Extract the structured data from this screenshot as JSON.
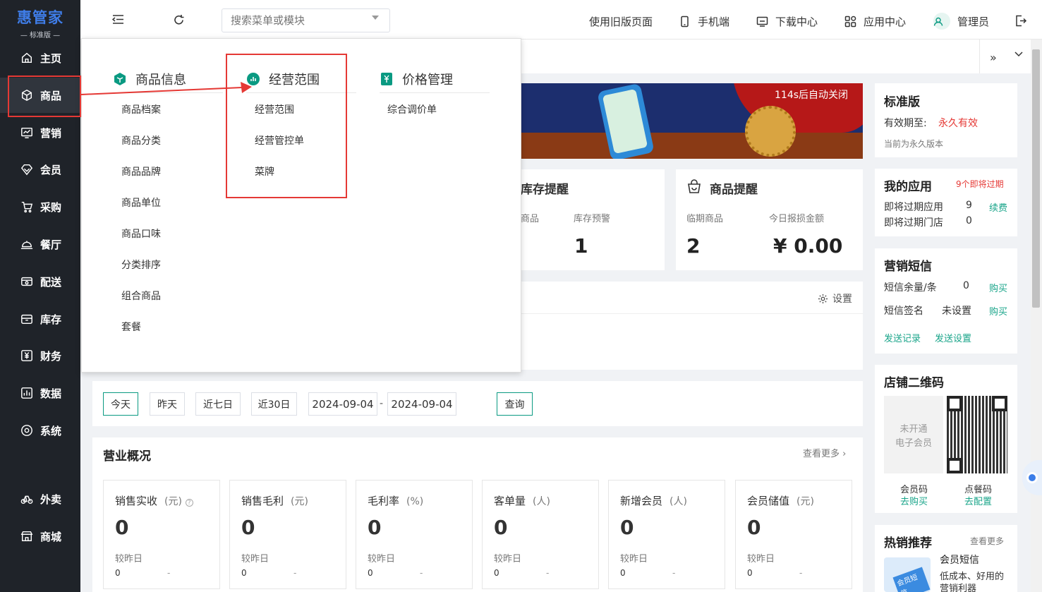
{
  "app": {
    "logo": "惠管家",
    "edition": "— 标准版 —"
  },
  "sidebar": {
    "items": [
      {
        "label": "主页",
        "icon": "home-icon"
      },
      {
        "label": "商品",
        "icon": "box-icon"
      },
      {
        "label": "营销",
        "icon": "chart-icon"
      },
      {
        "label": "会员",
        "icon": "diamond-icon"
      },
      {
        "label": "采购",
        "icon": "cart-icon"
      },
      {
        "label": "餐厅",
        "icon": "cloche-icon"
      },
      {
        "label": "配送",
        "icon": "truck-icon"
      },
      {
        "label": "库存",
        "icon": "inbox-icon"
      },
      {
        "label": "财务",
        "icon": "yen-icon"
      },
      {
        "label": "数据",
        "icon": "bar-chart-icon"
      },
      {
        "label": "系统",
        "icon": "settings-icon"
      },
      {
        "label": "外卖",
        "icon": "bike-icon"
      },
      {
        "label": "商城",
        "icon": "store-icon"
      }
    ]
  },
  "header": {
    "search_placeholder": "搜索菜单或模块",
    "old_page": "使用旧版页面",
    "mobile": "手机端",
    "download": "下载中心",
    "apps": "应用中心",
    "user": "管理员"
  },
  "dropdown": {
    "col1": {
      "title": "商品信息",
      "items": [
        "商品档案",
        "商品分类",
        "商品品牌",
        "商品单位",
        "商品口味",
        "分类排序",
        "组合商品",
        "套餐"
      ]
    },
    "col2": {
      "title": "经营范围",
      "items": [
        "经营范围",
        "经营管控单",
        "菜牌"
      ]
    },
    "col3": {
      "title": "价格管理",
      "items": [
        "综合调价单"
      ]
    }
  },
  "banner": {
    "countdown": "114s后自动关闭"
  },
  "stock_alert": {
    "title": "库存提醒",
    "label1": "商品",
    "label2": "库存预警",
    "value2": "1"
  },
  "goods_alert": {
    "title": "商品提醒",
    "label1": "临期商品",
    "value1": "2",
    "label2": "今日报损金额",
    "value2": "¥ 0.00"
  },
  "settings_label": "设置",
  "date_filter": {
    "today": "今天",
    "yesterday": "昨天",
    "seven": "近七日",
    "thirty": "近30日",
    "start": "2024-09-04",
    "sep": "-",
    "end": "2024-09-04",
    "query": "查询"
  },
  "overview": {
    "title": "营业概况",
    "more": "查看更多",
    "cards": [
      {
        "title": "销售实收",
        "unit": "(元)",
        "value": "0",
        "compare": "较昨日",
        "num": "0",
        "dash": "-"
      },
      {
        "title": "销售毛利",
        "unit": "(元)",
        "value": "0",
        "compare": "较昨日",
        "num": "0",
        "dash": "-"
      },
      {
        "title": "毛利率",
        "unit": "(%)",
        "value": "0",
        "compare": "较昨日",
        "num": "0",
        "dash": "-"
      },
      {
        "title": "客单量",
        "unit": "(人)",
        "value": "0",
        "compare": "较昨日",
        "num": "0",
        "dash": "-"
      },
      {
        "title": "新增会员",
        "unit": "(人)",
        "value": "0",
        "compare": "较昨日",
        "num": "0",
        "dash": "-"
      },
      {
        "title": "会员储值",
        "unit": "(元)",
        "value": "0",
        "compare": "较昨日",
        "num": "0",
        "dash": "-"
      }
    ]
  },
  "right": {
    "edition": {
      "title": "标准版",
      "expire_label": "有效期至:",
      "expire_value": "永久有效",
      "note": "当前为永久版本"
    },
    "myapps": {
      "title": "我的应用",
      "badge": "9个即将过期",
      "row1": "即将过期应用",
      "row1_val": "9",
      "row1_link": "续费",
      "row2": "即将过期门店",
      "row2_val": "0"
    },
    "sms": {
      "title": "营销短信",
      "row1": "短信余量/条",
      "row1_val": "0",
      "row1_link": "购买",
      "row2": "短信签名",
      "row2_val": "未设置",
      "row2_link": "购买",
      "link1": "发送记录",
      "link2": "发送设置"
    },
    "qr": {
      "title": "店铺二维码",
      "placeholder1": "未开通",
      "placeholder2": "电子会员",
      "label1": "会员码",
      "link1": "去购买",
      "label2": "点餐码",
      "link2": "去配置"
    },
    "hot": {
      "title": "热销推荐",
      "more": "查看更多",
      "item_title": "会员短信",
      "item_desc1": "低成本、好用的",
      "item_desc2": "营销利器",
      "img_text": "会员短信"
    }
  },
  "colors": {
    "sidebar": "#1f2329",
    "accent": "#0a9a82",
    "danger": "#e53935",
    "link": "#1aa58a"
  }
}
